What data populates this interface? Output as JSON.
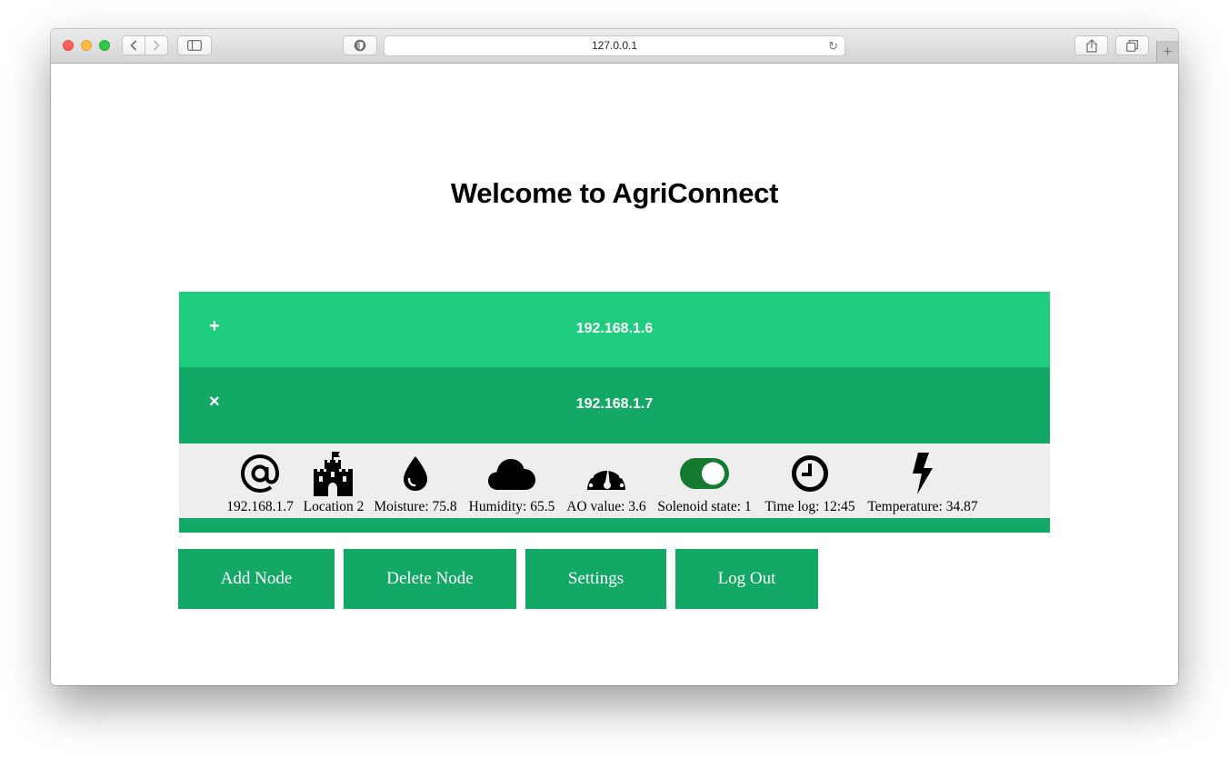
{
  "browser": {
    "url": "127.0.0.1"
  },
  "page": {
    "title": "Welcome to AgriConnect"
  },
  "nodes": [
    {
      "toggle": "+",
      "ip": "192.168.1.6",
      "expanded": false
    },
    {
      "toggle": "×",
      "ip": "192.168.1.7",
      "expanded": true
    }
  ],
  "details": {
    "ip": "192.168.1.7",
    "location": "Location 2",
    "moisture": "Moisture: 75.8",
    "humidity": "Humidity: 65.5",
    "ao_value": "AO value: 3.6",
    "solenoid": "Solenoid state: 1",
    "time_log": "Time log: 12:45",
    "temperature": "Temperature: 34.87"
  },
  "actions": {
    "add": "Add Node",
    "delete": "Delete Node",
    "settings": "Settings",
    "logout": "Log Out"
  },
  "colors": {
    "collapsed_header": "#1ecd7e",
    "expanded_header": "#13a865",
    "button": "#13a865",
    "toggle_on": "#137a30"
  }
}
